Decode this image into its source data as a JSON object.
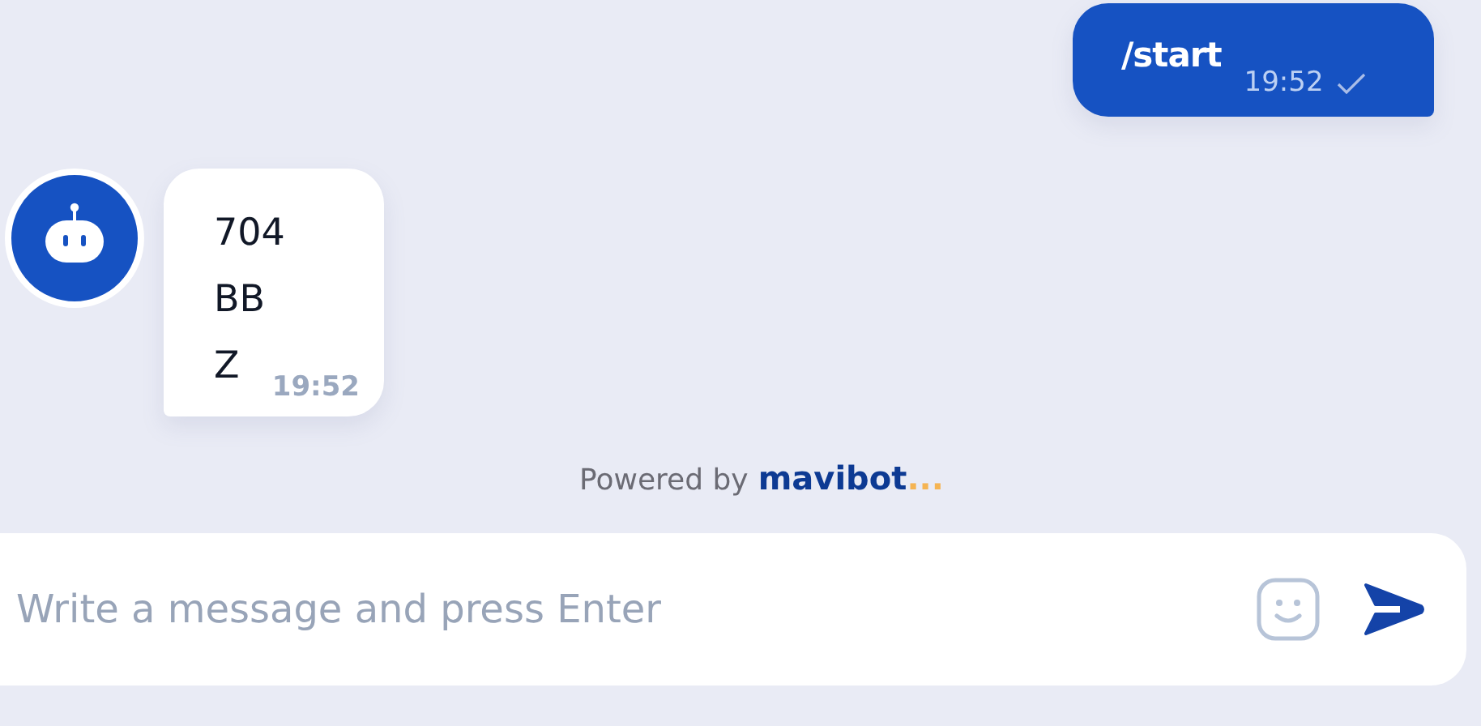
{
  "messages": [
    {
      "kind": "outgoing",
      "lines": [
        "/start"
      ],
      "time": "19:52",
      "read": true
    },
    {
      "kind": "incoming",
      "lines": [
        "704",
        "BB",
        "Z"
      ],
      "time": "19:52",
      "read": false
    }
  ],
  "powered_by": {
    "text": "Powered by",
    "brand": "mavibot",
    "brand_suffix": "..."
  },
  "composer": {
    "placeholder": "Write a message and press Enter"
  }
}
